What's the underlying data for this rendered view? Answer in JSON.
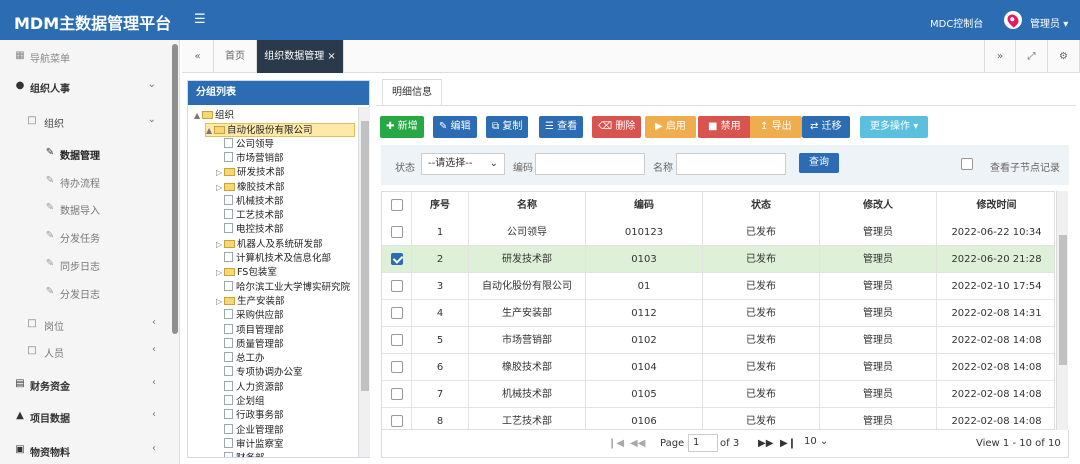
{
  "app": {
    "title": "MDM主数据管理平台",
    "control": "MDC控制台",
    "user": "管理员"
  },
  "sidebar": {
    "nav_title": "导航菜单",
    "items": [
      {
        "label": "组织人事"
      },
      {
        "label": "组织"
      },
      {
        "label": "数据管理"
      },
      {
        "label": "待办流程"
      },
      {
        "label": "数据导入"
      },
      {
        "label": "分发任务"
      },
      {
        "label": "同步日志"
      },
      {
        "label": "分发日志"
      },
      {
        "label": "岗位"
      },
      {
        "label": "人员"
      },
      {
        "label": "财务资金"
      },
      {
        "label": "项目数据"
      },
      {
        "label": "物资物料"
      }
    ]
  },
  "tabs": {
    "home": "首页",
    "active": "组织数据管理"
  },
  "tree": {
    "title": "分组列表",
    "nodes": [
      "组织",
      "自动化股份有限公司",
      "公司领导",
      "市场营销部",
      "研发技术部",
      "橡胶技术部",
      "机械技术部",
      "工艺技术部",
      "电控技术部",
      "机器人及系统研发部",
      "计算机技术及信息化部",
      "FS包装室",
      "哈尔滨工业大学博实研究院",
      "生产安装部",
      "采购供应部",
      "项目管理部",
      "质量管理部",
      "总工办",
      "专项协调办公室",
      "人力资源部",
      "企划组",
      "行政事务部",
      "企业管理部",
      "审计监察室",
      "财务部"
    ]
  },
  "main": {
    "subtab": "明细信息",
    "buttons": [
      "新增",
      "编辑",
      "复制",
      "查看",
      "删除",
      "启用",
      "禁用",
      "导出",
      "迁移",
      "更多操作"
    ],
    "filter": {
      "status_label": "状态",
      "status_value": "--请选择--",
      "code_label": "编码",
      "name_label": "名称",
      "query": "查询",
      "sub_records": "查看子节点记录"
    },
    "table": {
      "headers": [
        "序号",
        "名称",
        "编码",
        "状态",
        "修改人",
        "修改时间"
      ],
      "rows": [
        {
          "no": "1",
          "name": "公司领导",
          "code": "010123",
          "status": "已发布",
          "user": "管理员",
          "time": "2022-06-22 10:34"
        },
        {
          "no": "2",
          "name": "研发技术部",
          "code": "0103",
          "status": "已发布",
          "user": "管理员",
          "time": "2022-06-20 21:28"
        },
        {
          "no": "3",
          "name": "自动化股份有限公司",
          "code": "01",
          "status": "已发布",
          "user": "管理员",
          "time": "2022-02-10 17:54"
        },
        {
          "no": "4",
          "name": "生产安装部",
          "code": "0112",
          "status": "已发布",
          "user": "管理员",
          "time": "2022-02-08 14:31"
        },
        {
          "no": "5",
          "name": "市场营销部",
          "code": "0102",
          "status": "已发布",
          "user": "管理员",
          "time": "2022-02-08 14:08"
        },
        {
          "no": "6",
          "name": "橡胶技术部",
          "code": "0104",
          "status": "已发布",
          "user": "管理员",
          "time": "2022-02-08 14:08"
        },
        {
          "no": "7",
          "name": "机械技术部",
          "code": "0105",
          "status": "已发布",
          "user": "管理员",
          "time": "2022-02-08 14:08"
        },
        {
          "no": "8",
          "name": "工艺技术部",
          "code": "0106",
          "status": "已发布",
          "user": "管理员",
          "time": "2022-02-08 14:08"
        }
      ]
    },
    "pager": {
      "page_label": "Page",
      "page": "1",
      "of": "of 3",
      "size": "10",
      "summary": "View 1 - 10 of 10"
    }
  },
  "colors": {
    "brand": "#2b6cb3",
    "selected_row": "#dff0d8"
  }
}
